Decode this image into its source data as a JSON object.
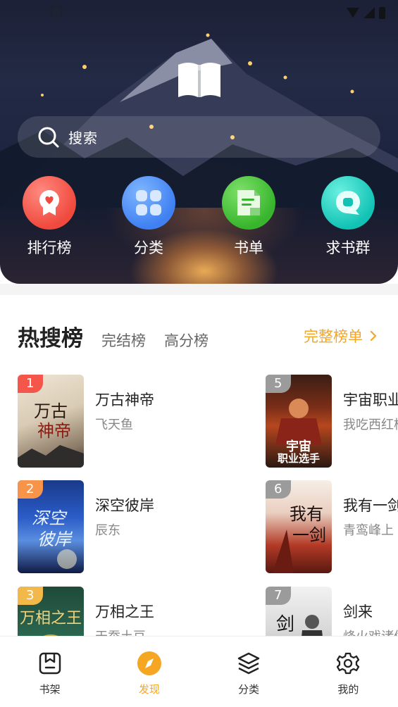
{
  "header": {
    "logo_icon": "open-book-icon",
    "search": {
      "placeholder": "搜索",
      "icon": "search-icon"
    },
    "quick_links": [
      {
        "label": "排行榜",
        "icon": "ranking-medal-icon",
        "color": "#f0493d"
      },
      {
        "label": "分类",
        "icon": "category-grid-icon",
        "color": "#3f80f2"
      },
      {
        "label": "书单",
        "icon": "booklist-icon",
        "color": "#37b52c"
      },
      {
        "label": "求书群",
        "icon": "chat-bubble-icon",
        "color": "#12c3b5"
      }
    ]
  },
  "ranking": {
    "tabs": [
      {
        "label": "热搜榜",
        "active": true
      },
      {
        "label": "完结榜",
        "active": false
      },
      {
        "label": "高分榜",
        "active": false
      }
    ],
    "full_link": "完整榜单",
    "accent": "#f5a623",
    "books": [
      {
        "rank": "1",
        "title": "万古神帝",
        "author": "飞天鱼",
        "badge_color": "#f4564b"
      },
      {
        "rank": "2",
        "title": "深空彼岸",
        "author": "辰东",
        "badge_color": "#f7944a"
      },
      {
        "rank": "3",
        "title": "万相之王",
        "author": "天蚕土豆",
        "badge_color": "#f3b84a"
      },
      {
        "rank": "5",
        "title": "宇宙职业",
        "author": "我吃西红柿",
        "badge_color": "#9b9b9b"
      },
      {
        "rank": "6",
        "title": "我有一剑",
        "author": "青鸾峰上",
        "badge_color": "#9b9b9b"
      },
      {
        "rank": "7",
        "title": "剑来",
        "author": "烽火戏诸侯",
        "badge_color": "#9b9b9b"
      }
    ]
  },
  "bottom_nav": [
    {
      "label": "书架",
      "icon": "bookshelf-icon",
      "active": false
    },
    {
      "label": "发现",
      "icon": "compass-icon",
      "active": true
    },
    {
      "label": "分类",
      "icon": "layers-icon",
      "active": false
    },
    {
      "label": "我的",
      "icon": "gear-icon",
      "active": false
    }
  ]
}
